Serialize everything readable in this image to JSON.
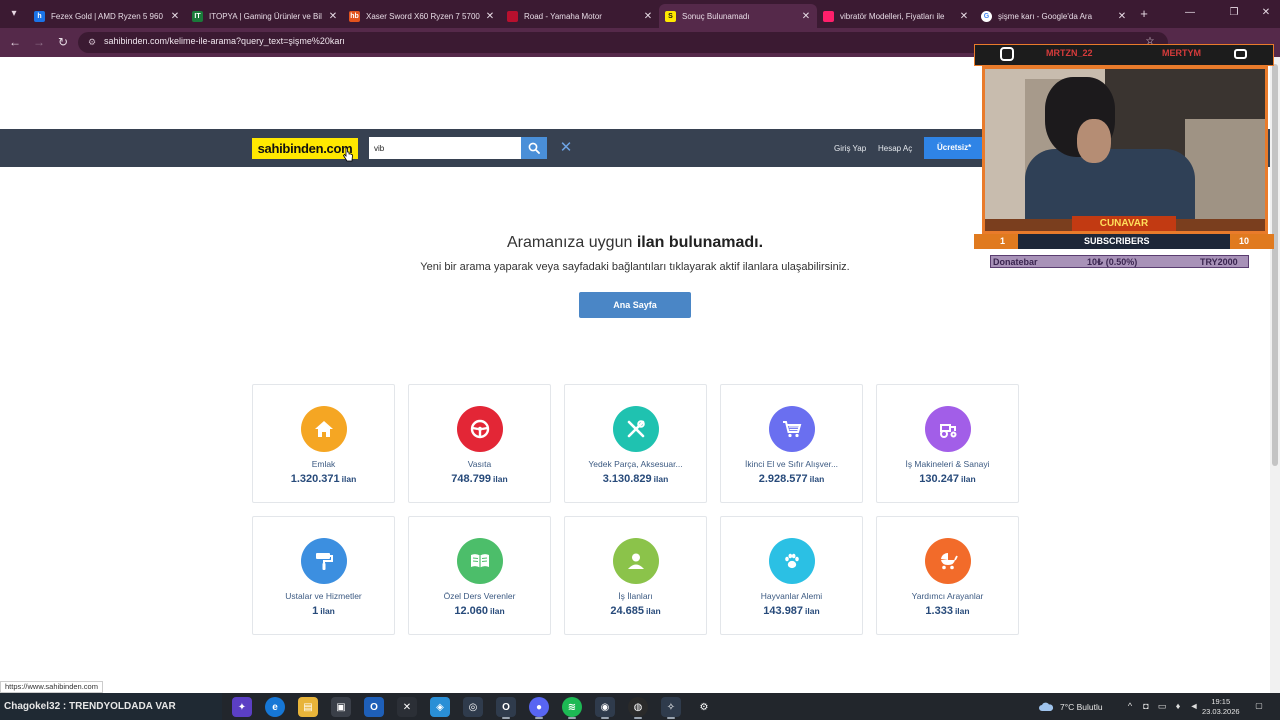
{
  "browser": {
    "tabs": [
      {
        "title": "Fezex Gold | AMD Ryzen 5 960",
        "fav_color": "#1a73e8",
        "fav_glyph": "h"
      },
      {
        "title": "ITOPYA | Gaming Ürünler ve Bil",
        "fav_color": "#1a7a3a",
        "fav_glyph": "IT"
      },
      {
        "title": "Xaser Sword X60 Ryzen 7 5700",
        "fav_color": "#e2531d",
        "fav_glyph": "hb"
      },
      {
        "title": "Road - Yamaha Motor",
        "fav_color": "#b8102e",
        "fav_glyph": ""
      },
      {
        "title": "Sonuç Bulunamadı",
        "fav_color": "#ffe800",
        "fav_glyph": "S"
      },
      {
        "title": "vibratör Modelleri, Fiyatları ile",
        "fav_color": "#ff1f6b",
        "fav_glyph": ""
      },
      {
        "title": "şişme karı - Google'da Ara",
        "fav_color": "#ffffff",
        "fav_glyph": "G"
      }
    ],
    "address": "sahibinden.com/kelime-ile-arama?query_text=şişme%20karı",
    "status_url": "https://www.sahibinden.com"
  },
  "header": {
    "logo": "sahibinden.com",
    "search_value": "vib",
    "login": "Giriş Yap",
    "register": "Hesap Aç",
    "cta": "Ücretsiz*"
  },
  "message": {
    "title_plain": "Aramanıza uygun ",
    "title_bold": "ilan bulunamadı.",
    "subtitle": "Yeni bir arama yaparak veya sayfadaki bağlantıları tıklayarak aktif ilanlara ulaşabilirsiniz.",
    "home_button": "Ana Sayfa"
  },
  "categories": [
    {
      "name": "Emlak",
      "count": "1.320.371",
      "unit": "ilan",
      "color": "#f5a623",
      "icon": "house-icon"
    },
    {
      "name": "Vasıta",
      "count": "748.799",
      "unit": "ilan",
      "color": "#e32636",
      "icon": "steering-wheel-icon"
    },
    {
      "name": "Yedek Parça, Aksesuar...",
      "count": "3.130.829",
      "unit": "ilan",
      "color": "#1fc2b0",
      "icon": "tools-icon"
    },
    {
      "name": "İkinci El ve Sıfır Alışver...",
      "count": "2.928.577",
      "unit": "ilan",
      "color": "#6a6ff0",
      "icon": "shopping-cart-icon"
    },
    {
      "name": "İş Makineleri & Sanayi",
      "count": "130.247",
      "unit": "ilan",
      "color": "#a25ee8",
      "icon": "tractor-icon"
    },
    {
      "name": "Ustalar ve Hizmetler",
      "count": "1",
      "unit": "ilan",
      "color": "#3c8fe0",
      "icon": "paint-roller-icon"
    },
    {
      "name": "Özel Ders Verenler",
      "count": "12.060",
      "unit": "ilan",
      "color": "#4cbe6a",
      "icon": "book-icon"
    },
    {
      "name": "İş İlanları",
      "count": "24.685",
      "unit": "ilan",
      "color": "#8bc34a",
      "icon": "person-icon"
    },
    {
      "name": "Hayvanlar Alemi",
      "count": "143.987",
      "unit": "ilan",
      "color": "#2bc0e4",
      "icon": "paw-icon"
    },
    {
      "name": "Yardımcı Arayanlar",
      "count": "1.333",
      "unit": "ilan",
      "color": "#f26b2a",
      "icon": "stroller-icon"
    }
  ],
  "overlay": {
    "name_left": "MRTZN_22",
    "name_right": "MERTYM",
    "brand": "CUNAVAR",
    "sub_left": "1",
    "sub_label": "SUBSCRIBERS",
    "sub_right": "10",
    "donate_label": "Donatebar",
    "donate_amount": "10₺ (0.50%)",
    "donate_goal": "TRY2000"
  },
  "taskbar": {
    "ticker": "Chagokel32 : TRENDYOLDADA VAR",
    "weather": "7°C  Bulutlu",
    "time": "19:15",
    "date": "23.03.2026"
  }
}
